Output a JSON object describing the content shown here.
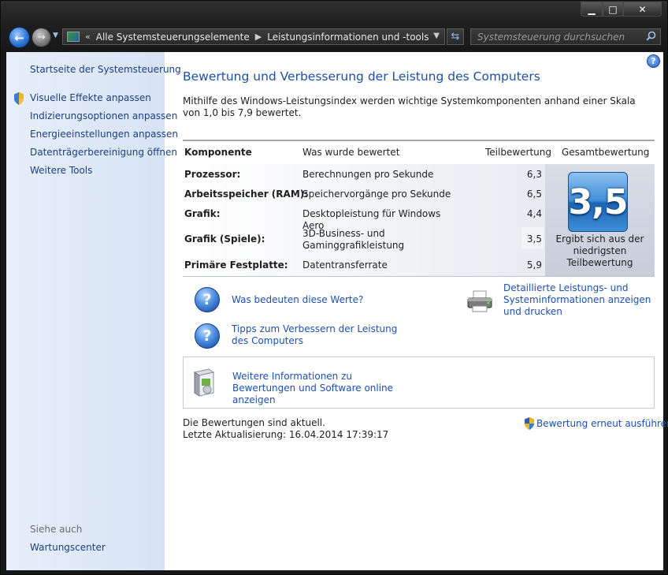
{
  "window": {
    "min_label": "▁",
    "max_label": "□",
    "close_label": "✕"
  },
  "address": {
    "history_marker": "«",
    "crumbs": [
      "Alle Systemsteuerungselemente",
      "Leistungsinformationen und -tools"
    ],
    "separator": "▶"
  },
  "search": {
    "placeholder": "Systemsteuerung durchsuchen"
  },
  "sidebar": {
    "home": "Startseite der Systemsteuerung",
    "items": [
      "Visuelle Effekte anpassen",
      "Indizierungsoptionen anpassen",
      "Energieeinstellungen anpassen",
      "Datenträgerbereinigung öffnen",
      "Weitere Tools"
    ],
    "see_also_heading": "Siehe auch",
    "see_also_items": [
      "Wartungscenter"
    ]
  },
  "main": {
    "title": "Bewertung und Verbesserung der Leistung des Computers",
    "intro": "Mithilfe des Windows-Leistungsindex werden wichtige Systemkomponenten anhand einer Skala von 1,0 bis 7,9 bewertet.",
    "table": {
      "headers": {
        "component": "Komponente",
        "rated": "Was wurde bewertet",
        "subscore": "Teilbewertung",
        "total": "Gesamtbewertung"
      },
      "rows": [
        {
          "component": "Prozessor:",
          "description": "Berechnungen pro Sekunde",
          "score": "6,3"
        },
        {
          "component": "Arbeitsspeicher (RAM):",
          "description": "Speichervorgänge pro Sekunde",
          "score": "6,5"
        },
        {
          "component": "Grafik:",
          "description": "Desktopleistung für Windows Aero",
          "score": "4,4"
        },
        {
          "component": "Grafik (Spiele):",
          "description": "3D-Business- und Gaminggrafikleistung",
          "score": "3,5"
        },
        {
          "component": "Primäre Festplatte:",
          "description": "Datentransferrate",
          "score": "5,9"
        }
      ],
      "total_score": "3,5",
      "total_caption": "Ergibt sich aus der niedrigsten Teilbewertung"
    },
    "links": {
      "what_values_mean": "Was bedeuten diese Werte?",
      "tips": "Tipps zum Verbessern der Leistung des Computers",
      "details": "Detaillierte Leistungs- und Systeminformationen anzeigen und drucken",
      "online_info": "Weitere Informationen zu Bewertungen und Software online anzeigen"
    },
    "status": {
      "current": "Die Bewertungen sind aktuell.",
      "last_update_label": "Letzte Aktualisierung:",
      "last_update_value": "16.04.2014 17:39:17"
    },
    "rerun_label": "Bewertung erneut ausführen",
    "help_glyph": "?"
  },
  "colors": {
    "link": "#1e4fb0",
    "title": "#1e4fa3",
    "sidebar_link": "#1c3f7c",
    "badge": "#3f8fd6"
  },
  "icons": [
    "back-arrow-icon",
    "forward-arrow-icon",
    "refresh-icon",
    "search-icon",
    "shield-icon",
    "help-icon",
    "question-icon",
    "printer-icon",
    "software-box-icon"
  ]
}
